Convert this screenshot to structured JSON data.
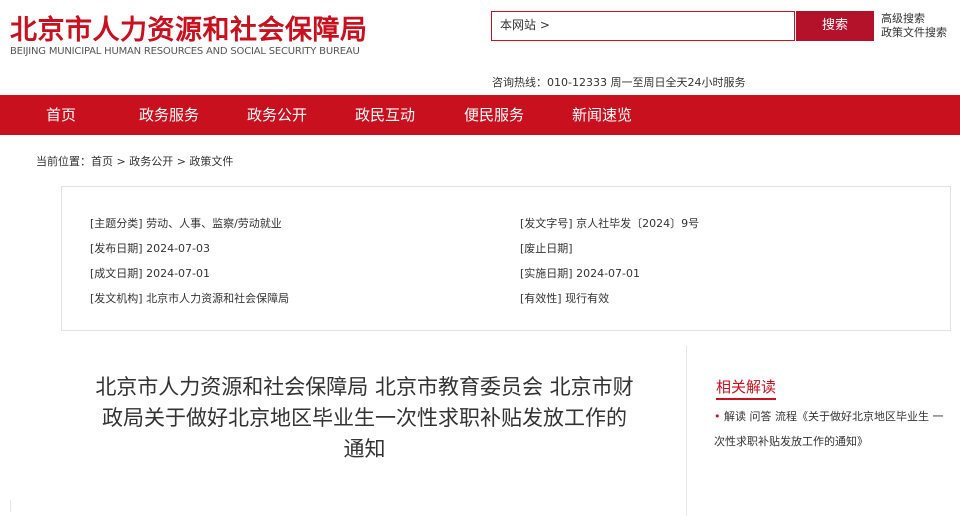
{
  "header": {
    "logo_cn": "北京市人力资源和社会保障局",
    "logo_en": "BEIJING MUNICIPAL HUMAN RESOURCES AND SOCIAL SECURITY BUREAU",
    "search_value": "本网站 >",
    "search_button": "搜索",
    "advanced_search": "高级搜索",
    "policy_search": "政策文件搜索",
    "hotline": "咨询热线：010-12333 周一至周日全天24小时服务"
  },
  "nav": {
    "items": [
      {
        "label": "首页"
      },
      {
        "label": "政务服务"
      },
      {
        "label": "政务公开"
      },
      {
        "label": "政民互动"
      },
      {
        "label": "便民服务"
      },
      {
        "label": "新闻速览"
      }
    ]
  },
  "breadcrumb": "当前位置：首页 > 政务公开 > 政策文件",
  "meta": {
    "topic_key": "[主题分类]",
    "topic_val": "劳动、人事、监察/劳动就业",
    "doc_no_key": "[发文字号]",
    "doc_no_val": "京人社毕发〔2024〕9号",
    "publish_key": "[发布日期]",
    "publish_val": "2024-07-03",
    "abolish_key": "[废止日期]",
    "abolish_val": "",
    "written_key": "[成文日期]",
    "written_val": "2024-07-01",
    "effective_key": "[实施日期]",
    "effective_val": "2024-07-01",
    "issuer_key": "[发文机构]",
    "issuer_val": "北京市人力资源和社会保障局",
    "validity_key": "[有效性]",
    "validity_val": "现行有效"
  },
  "article": {
    "title": "北京市人力资源和社会保障局 北京市教育委员会 北京市财政局关于做好北京地区毕业生一次性求职补贴发放工作的通知"
  },
  "related": {
    "heading": "相关解读",
    "bullet": "•",
    "item": "解读 问答 流程《关于做好北京地区毕业生 一次性求职补贴发放工作的通知》"
  },
  "colors": {
    "brand_red": "#c8101e",
    "button_red": "#b3122a"
  }
}
